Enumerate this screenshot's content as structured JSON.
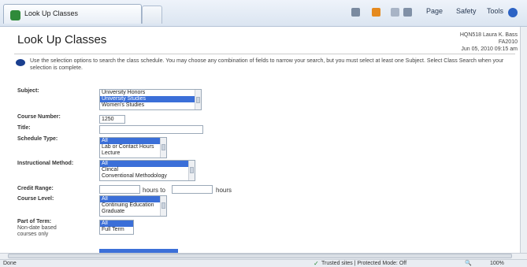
{
  "browser": {
    "tab_title": "Look Up Classes",
    "commands": {
      "page": "Page",
      "safety": "Safety",
      "tools": "Tools"
    }
  },
  "page": {
    "title": "Look Up Classes",
    "user": {
      "line1": "HQN518 Laura K. Bass",
      "line2": "FA2010",
      "line3": "Jun 05, 2010 09:15 am"
    },
    "instructions": "Use the selection options to search the class schedule. You may choose any combination of fields to narrow your search, but you must select at least one Subject. Select Class Search when your selection is complete."
  },
  "form": {
    "subject": {
      "label": "Subject:",
      "options": [
        "University Honors",
        "University Studies",
        "Women's Studies"
      ],
      "selected": "University Studies"
    },
    "course_number": {
      "label": "Course Number:",
      "value": "1250"
    },
    "title": {
      "label": "Title:",
      "value": ""
    },
    "schedule_type": {
      "label": "Schedule Type:",
      "options": [
        "All",
        "Lab or Contact Hours",
        "Lecture"
      ],
      "selected": "All"
    },
    "instructional_method": {
      "label": "Instructional Method:",
      "options": [
        "All",
        "Clincal",
        "Conventional Methodology"
      ],
      "selected": "All"
    },
    "credit_range": {
      "label": "Credit Range:",
      "hours_to": "hours to",
      "hours": "hours"
    },
    "course_level": {
      "label": "Course Level:",
      "options": [
        "All",
        "Continuing Education",
        "Graduate"
      ],
      "selected": "All"
    },
    "part_of_term": {
      "label": "Part of Term:",
      "sublabel": "Non-date based courses only",
      "options": [
        "All",
        "Full Term"
      ],
      "selected": "All"
    }
  },
  "status": {
    "left": "Done",
    "zone": "Trusted sites | Protected Mode: Off",
    "zoom": "100%"
  },
  "colors": {
    "selection": "#3b6fd8",
    "chrome": "#dbe5f1"
  }
}
